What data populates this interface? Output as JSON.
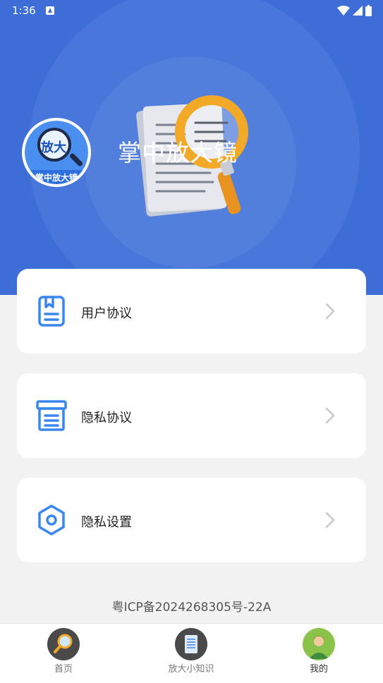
{
  "status_bar": {
    "time": "1:36"
  },
  "profile": {
    "app_name": "掌中放大镜",
    "avatar_big_text": "放大",
    "avatar_small_text": "掌中放大镜"
  },
  "menu": [
    {
      "label": "用户协议",
      "icon": "document-bookmark-icon"
    },
    {
      "label": "隐私协议",
      "icon": "archive-box-icon"
    },
    {
      "label": "隐私设置",
      "icon": "hexagon-settings-icon"
    }
  ],
  "footer": {
    "icp": "粤ICP备2024268305号-22A"
  },
  "tabs": [
    {
      "label": "首页",
      "icon": "magnifier-icon"
    },
    {
      "label": "放大小知识",
      "icon": "notebook-icon"
    },
    {
      "label": "我的",
      "icon": "user-avatar-icon",
      "active": true
    }
  ],
  "colors": {
    "header_bg": "#3d6ed8",
    "icon_blue": "#3a86f0",
    "page_bg": "#f2f2f2"
  }
}
